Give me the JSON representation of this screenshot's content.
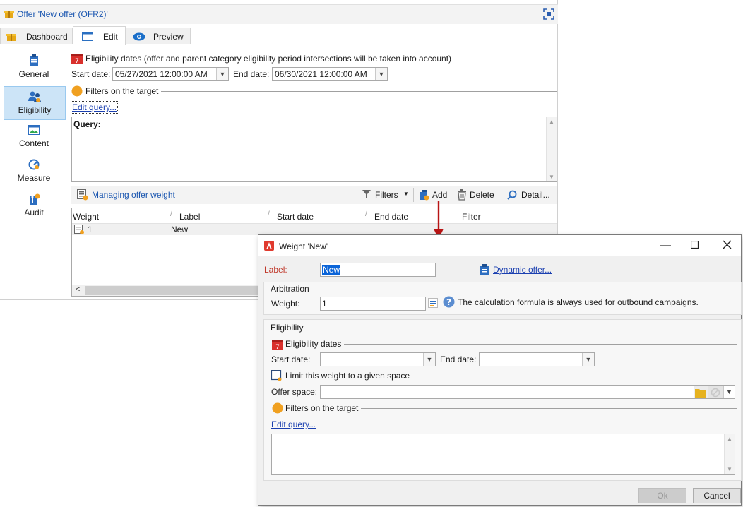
{
  "window": {
    "title": "Offer 'New offer (OFR2)'"
  },
  "tabs": [
    {
      "label": "Dashboard"
    },
    {
      "label": "Edit"
    },
    {
      "label": "Preview"
    }
  ],
  "sidebar": {
    "items": [
      {
        "label": "General",
        "icon": "clipboard-icon"
      },
      {
        "label": "Eligibility",
        "icon": "eligibility-users-icon"
      },
      {
        "label": "Content",
        "icon": "picture-icon"
      },
      {
        "label": "Measure",
        "icon": "gauge-icon"
      },
      {
        "label": "Audit",
        "icon": "audit-icon"
      }
    ],
    "selected": "Eligibility"
  },
  "eligibility": {
    "section_title": "Eligibility dates (offer and parent category eligibility period intersections will be taken into account)",
    "start_label": "Start date:",
    "start_value": "05/27/2021 12:00:00 AM",
    "end_label": "End date:",
    "end_value": "06/30/2021 12:00:00 AM",
    "filters_title": "Filters on the target",
    "edit_query": "Edit query...",
    "query_label": "Query:"
  },
  "weights_toolbar": {
    "title": "Managing offer weight",
    "filters": "Filters",
    "add": "Add",
    "delete": "Delete",
    "detail": "Detail..."
  },
  "weights_table": {
    "columns": [
      "Weight",
      "Label",
      "Start date",
      "End date",
      "Filter"
    ],
    "rows": [
      {
        "weight": "1",
        "label": "New",
        "start": "",
        "end": "",
        "filter": ""
      }
    ]
  },
  "dialog": {
    "title": "Weight 'New'",
    "label_caption": "Label:",
    "label_value": "New",
    "dynamic_offer": "Dynamic offer...",
    "arbitration_title": "Arbitration",
    "weight_caption": "Weight:",
    "weight_value": "1",
    "help_text": "The calculation formula is always used for outbound campaigns.",
    "eligibility_title": "Eligibility",
    "eligibility_dates": "Eligibility dates",
    "start_label": "Start date:",
    "end_label": "End date:",
    "limit_space": "Limit this weight to a given space",
    "offer_space_label": "Offer space:",
    "filters_title": "Filters on the target",
    "edit_query": "Edit query...",
    "ok": "Ok",
    "cancel": "Cancel"
  },
  "colors": {
    "accent_link": "#1a3fb0",
    "selected_sidebar": "#cce4f7",
    "label_required": "#c0392b",
    "arrow": "#b81414",
    "calendar_red": "#d9302c",
    "filter_orange": "#f0a020"
  }
}
